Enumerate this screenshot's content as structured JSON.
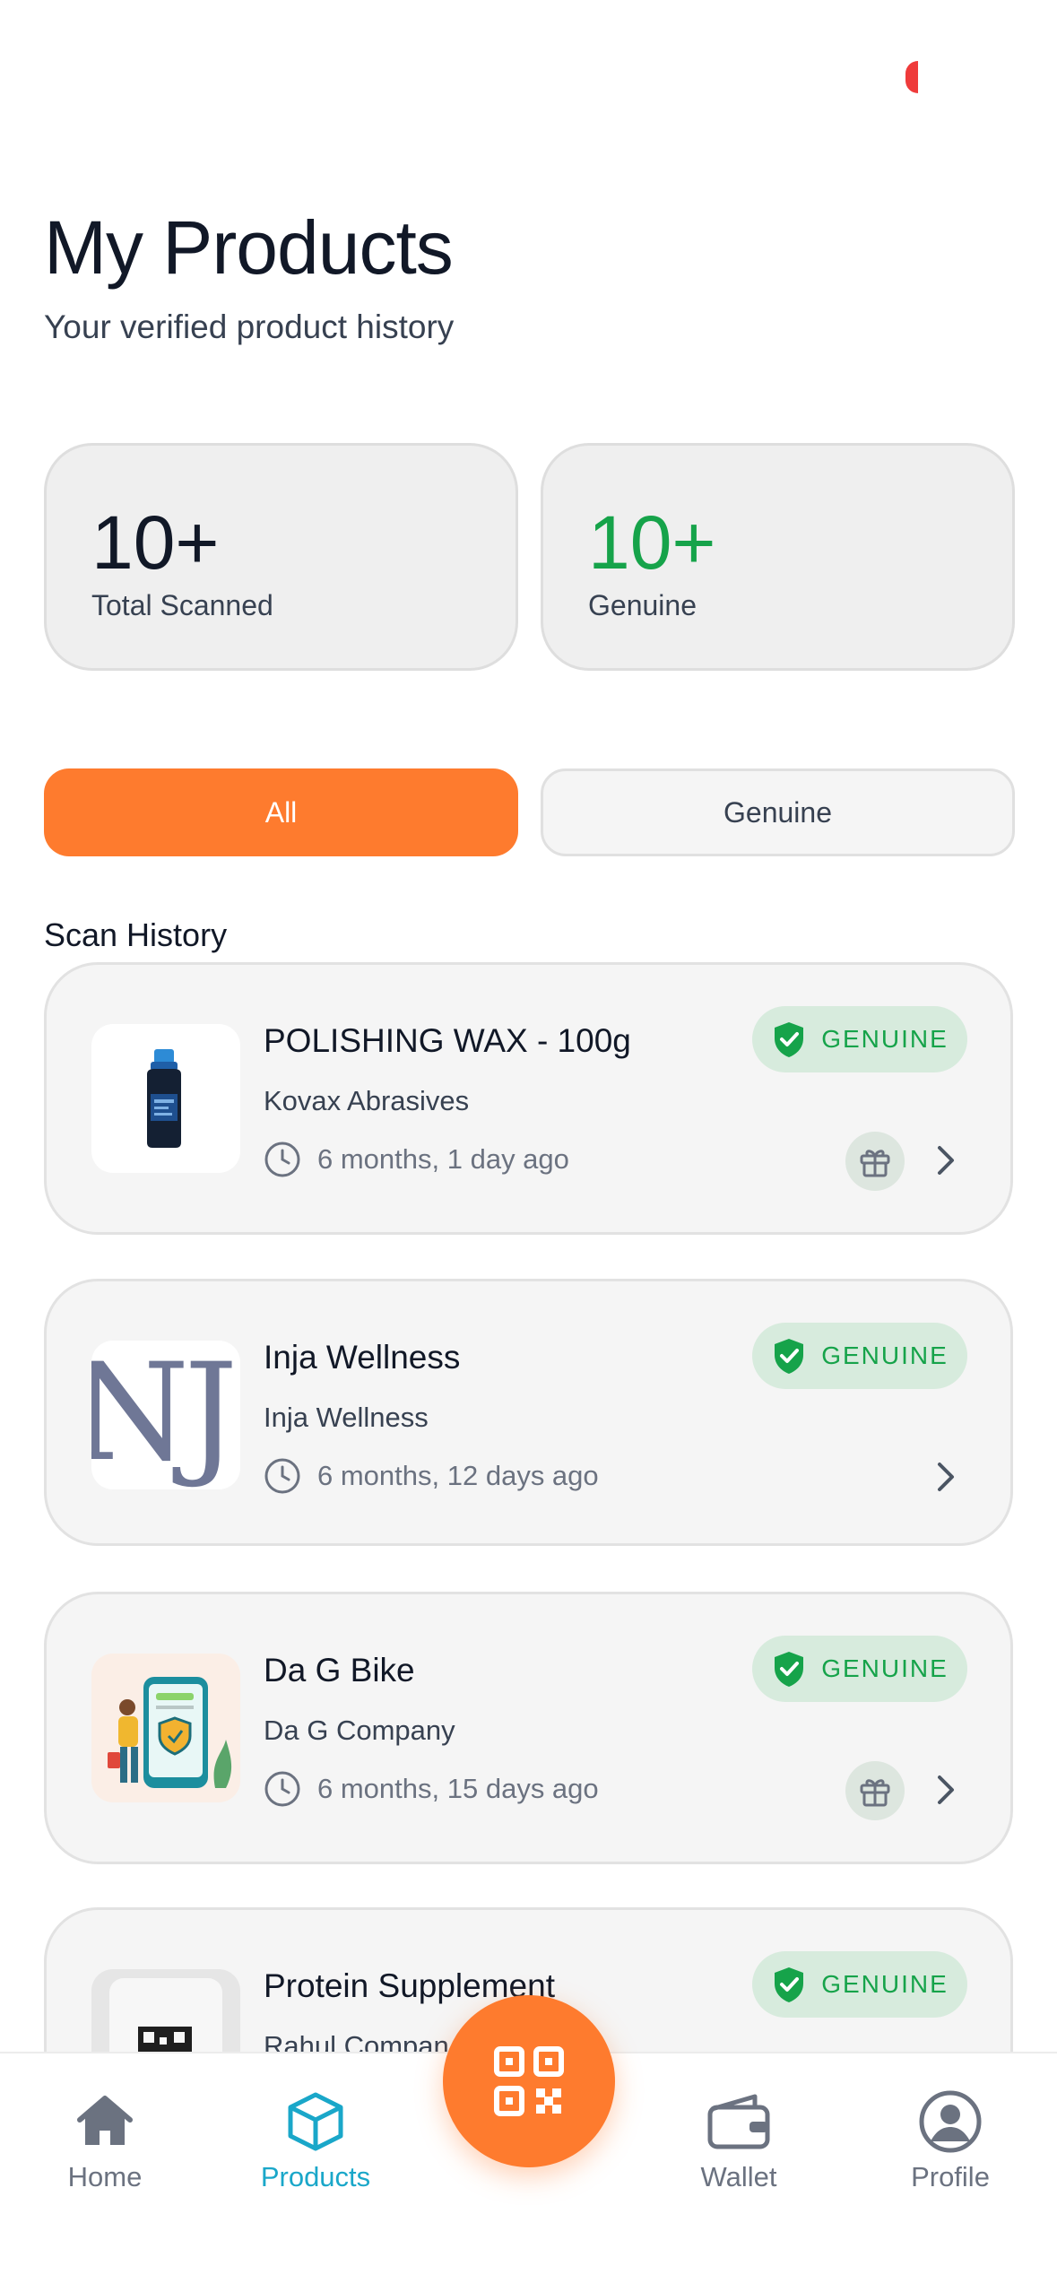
{
  "header": {
    "title": "My Products",
    "subtitle": "Your verified product history"
  },
  "stats": [
    {
      "value": "10+",
      "label": "Total Scanned"
    },
    {
      "value": "10+",
      "label": "Genuine"
    }
  ],
  "filters": {
    "all_label": "All",
    "genuine_label": "Genuine",
    "selected": "All"
  },
  "section_title": "Scan History",
  "products": [
    {
      "name": "POLISHING WAX - 100g",
      "brand": "Kovax Abrasives",
      "time": "6 months, 1 day ago",
      "badge": "GENUINE",
      "has_gift": true
    },
    {
      "name": "Inja Wellness",
      "brand": "Inja Wellness",
      "time": "6 months, 12 days ago",
      "badge": "GENUINE",
      "has_gift": false
    },
    {
      "name": "Da G Bike",
      "brand": "Da G Company",
      "time": "6 months, 15 days ago",
      "badge": "GENUINE",
      "has_gift": true
    },
    {
      "name": "Protein Supplement",
      "brand": "Rahul Compan",
      "time": "",
      "badge": "GENUINE",
      "has_gift": false
    }
  ],
  "thumb_texts": {
    "inja_logo": "NJ"
  },
  "nav": {
    "home": "Home",
    "products": "Products",
    "wallet": "Wallet",
    "profile": "Profile",
    "active": "Products"
  },
  "colors": {
    "accent": "#fe7b2e",
    "genuine": "#16a34a",
    "active_nav": "#1aa7c9"
  }
}
